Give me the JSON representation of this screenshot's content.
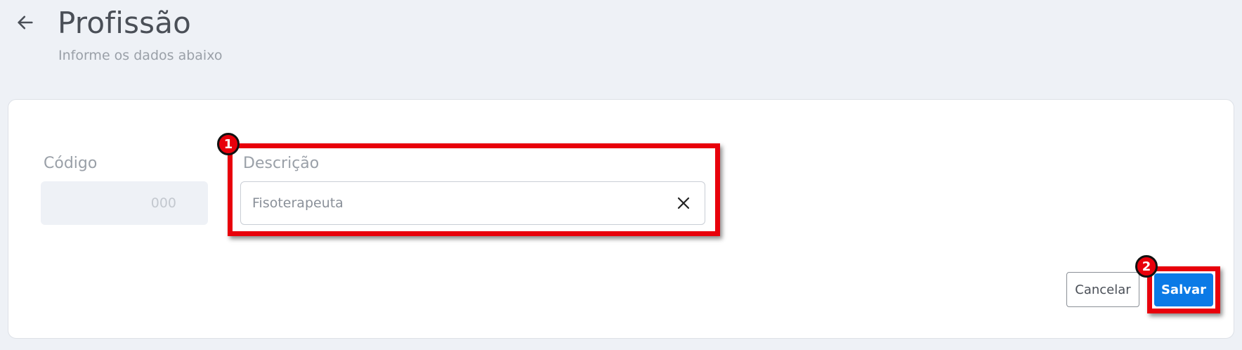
{
  "header": {
    "title": "Profissão",
    "subtitle": "Informe os dados abaixo"
  },
  "form": {
    "codigo": {
      "label": "Código",
      "value": "000"
    },
    "descricao": {
      "label": "Descrição",
      "value": "Fisoterapeuta"
    }
  },
  "actions": {
    "cancel_label": "Cancelar",
    "save_label": "Salvar"
  },
  "annotations": {
    "marker_1": "1",
    "marker_2": "2",
    "highlight_color": "#e8000b"
  },
  "colors": {
    "primary": "#0b7ae6",
    "background": "#eef1f6"
  },
  "icons": {
    "back": "arrow-left-icon",
    "clear": "close-icon"
  }
}
